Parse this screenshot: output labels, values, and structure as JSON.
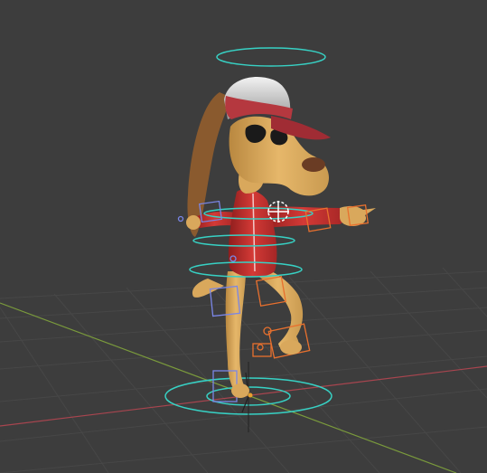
{
  "viewport": {
    "colors": {
      "background": "#3d3d3d",
      "grid": "#474747",
      "x_axis": "#a8454f",
      "y_axis": "#7a9a3c",
      "z_axis": "#3a5f97",
      "rig_cyan": "#37d1c4",
      "rig_orange": "#e8702e",
      "rig_blue": "#7a86e6",
      "body_tan": "#d9a85c",
      "shirt_red": "#c42e2e",
      "cap_red": "#b5383f",
      "cap_white": "#d6d6d6",
      "ear_brown": "#8a5a2e"
    },
    "character": {
      "description_icon": "cartoon-dog-icon"
    }
  }
}
